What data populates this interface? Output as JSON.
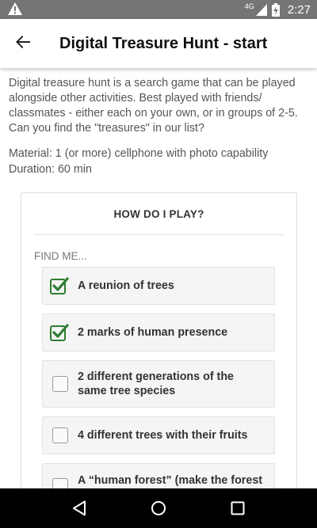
{
  "status_bar": {
    "network": "4G",
    "time": "2:27",
    "icons": [
      "warning-icon",
      "signal-icon",
      "battery-charging-icon"
    ]
  },
  "app_bar": {
    "title": "Digital Treasure Hunt - start",
    "back_icon": "arrow-left-icon"
  },
  "intro": "Digital treasure hunt is a search game that can be played alongside other activities.  Best played with friends/ classmates - either each on your own, or in groups of 2-5. Can you find the \"treasures\" in our list?",
  "material": "Material: 1 (or more) cellphone with photo capability",
  "duration": "Duration: 60 min",
  "card": {
    "heading": "HOW DO I PLAY?",
    "find_label": "FIND ME...",
    "items": [
      {
        "label": "A reunion of trees",
        "checked": true
      },
      {
        "label": "2 marks of human presence",
        "checked": true
      },
      {
        "label": "2 different generations of the same tree species",
        "checked": false
      },
      {
        "label": "4 different trees with their fruits",
        "checked": false
      },
      {
        "label": "A “human forest” (make the forest",
        "checked": false
      }
    ]
  },
  "colors": {
    "check_green": "#2e7d32",
    "status_bar": "#757575"
  },
  "nav_bar": {
    "icons": [
      "back-triangle-icon",
      "home-circle-icon",
      "recents-square-icon"
    ]
  }
}
